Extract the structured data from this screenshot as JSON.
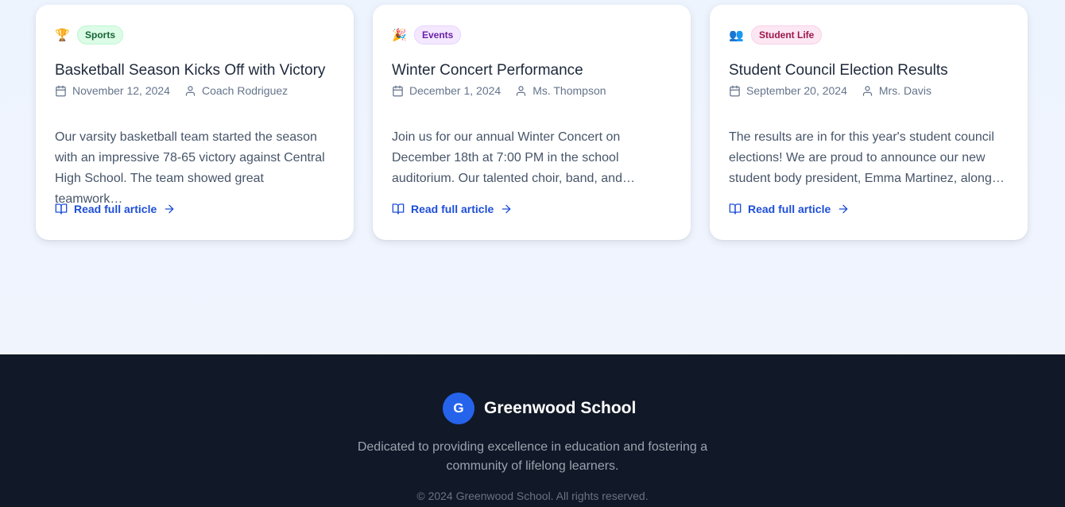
{
  "articles": [
    {
      "emoji": "🏆",
      "category": "Sports",
      "badge_style": "sports",
      "title": "Basketball Season Kicks Off with Victory",
      "date": "November 12, 2024",
      "author": "Coach Rodriguez",
      "excerpt": "Our varsity basketball team started the season with an impressive 78-65 victory against Central High School. The team showed great teamwork…",
      "read_label": "Read full article"
    },
    {
      "emoji": "🎉",
      "category": "Events",
      "badge_style": "events",
      "title": "Winter Concert Performance",
      "date": "December 1, 2024",
      "author": "Ms. Thompson",
      "excerpt": "Join us for our annual Winter Concert on December 18th at 7:00 PM in the school auditorium. Our talented choir, band, and…",
      "read_label": "Read full article"
    },
    {
      "emoji": "👥",
      "category": "Student Life",
      "badge_style": "studentlife",
      "title": "Student Council Election Results",
      "date": "September 20, 2024",
      "author": "Mrs. Davis",
      "excerpt": "The results are in for this year's student council elections! We are proud to announce our new student body president, Emma Martinez, along…",
      "read_label": "Read full article"
    }
  ],
  "footer": {
    "logo_letter": "G",
    "school_name": "Greenwood School",
    "tagline_line1": "Dedicated to providing excellence in education and fostering a",
    "tagline_line2": "community of lifelong learners.",
    "copyright": "© 2024 Greenwood School. All rights reserved."
  },
  "colors": {
    "accent": "#2563eb",
    "link": "#1d4ed8",
    "footer_bg": "#111827"
  },
  "icons": {
    "date": "calendar-icon",
    "author": "user-icon",
    "read": "book-open-icon",
    "arrow": "arrow-right-icon"
  }
}
